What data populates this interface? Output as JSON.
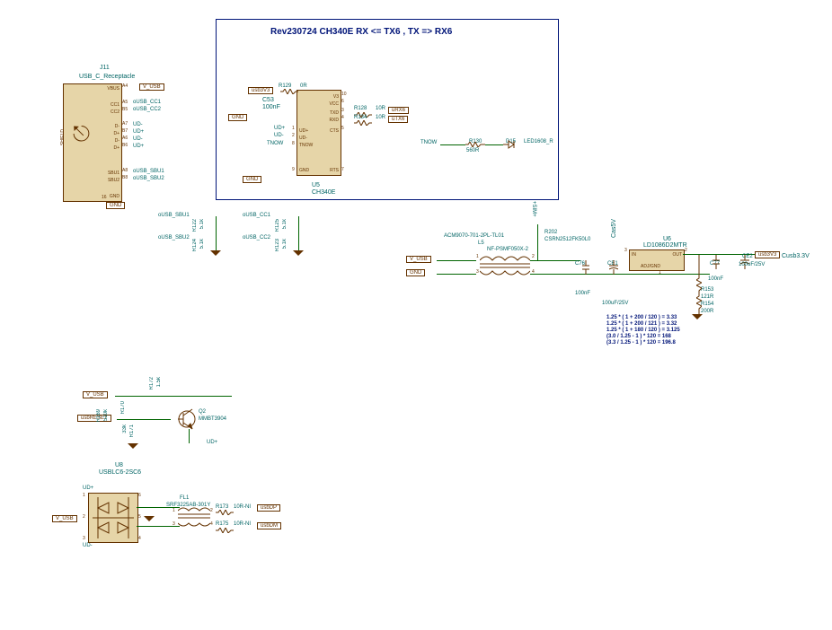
{
  "title": "Rev230724 CH340E RX <= TX6 , TX => RX6",
  "usb_conn": {
    "ref": "J11",
    "name": "USB_C_Receptacle",
    "shield": "SHIELD",
    "pins": {
      "vbus": "VBUS",
      "cc1": "CC1",
      "cc2": "CC2",
      "dn1": "D-",
      "dp1": "D+",
      "dn2": "D-",
      "dp2": "D+",
      "sbu1": "SBU1",
      "sbu2": "SBU2",
      "gnd": "GND"
    },
    "nos": {
      "a4": "A4",
      "a5": "A5",
      "b5": "B5",
      "a7": "A7",
      "b7": "B7",
      "a6": "A6",
      "b6": "B6",
      "a8": "A8",
      "b8": "B8",
      "g": "16"
    },
    "nets": {
      "vusb": "V_USB",
      "cc1": "oUSB_CC1",
      "cc2": "oUSB_CC2",
      "ud_m": "UD-",
      "ud_p": "UD+",
      "sbu1": "oUSB_SBU1",
      "sbu2": "oUSB_SBU2",
      "gnd": "GND"
    }
  },
  "ch340": {
    "ref": "U5",
    "name": "CH340E",
    "pins": {
      "v3": "V3",
      "vcc": "VCC",
      "txd": "TXD",
      "rxd": "RXD",
      "cts": "CTS",
      "udp": "UD+",
      "udm": "UD-",
      "tnow": "TNOW",
      "gnd": "GND",
      "rts": "RTS"
    },
    "pnos": {
      "v3": "10",
      "vcc": "6",
      "txd": "3",
      "rxd": "4",
      "cts": "5",
      "udp": "1",
      "udm": "2",
      "tnow": "8",
      "gnd": "9",
      "rts": "7"
    },
    "r129": {
      "ref": "R129",
      "val": "0R"
    },
    "c53": {
      "ref": "C53",
      "val": "100nF"
    },
    "tx": {
      "r": "R128",
      "v": "10R",
      "net": "uRX6"
    },
    "rx": {
      "r": "R134",
      "v": "10R",
      "net": "uTX6"
    },
    "tnow": {
      "r": "R130",
      "v": "560R",
      "d": "D15",
      "led": "LED1608_R",
      "lbl": "TNOW"
    },
    "gnd_net": "GND",
    "v33_net": "usb3V3"
  },
  "sbu": {
    "n1": "oUSB_SBU1",
    "n2": "oUSB_SBU2",
    "r1": "R122",
    "r2": "R124",
    "rv": "5.1k"
  },
  "cc": {
    "n1": "oUSB_CC1",
    "n2": "oUSB_CC2",
    "r1": "R125",
    "r2": "R123",
    "rv": "5.1k"
  },
  "psu": {
    "vusb": "V_USB",
    "gnd": "GND",
    "cm": {
      "name": "ACM9070-701-2PL-TL01",
      "ref": "L5",
      "sub": "NF-PSMF050X-2",
      "pins": {
        "a": "1",
        "b": "2",
        "c": "3",
        "d": "4"
      }
    },
    "r202": {
      "ref": "R202",
      "name": "CSRN2512FK50L0"
    },
    "c76": {
      "ref": "C76",
      "val": "100nF"
    },
    "ce1": {
      "ref": "CE1",
      "val": "100uF/25V"
    },
    "casev": "Cas5V",
    "reg": {
      "ref": "U6",
      "name": "LD1086D2MTR",
      "in": "IN",
      "out": "OUT",
      "adj": "ADJ/GND",
      "pi": "3",
      "po": "2",
      "pa": "1"
    },
    "c77": {
      "ref": "C77",
      "val": "100nF"
    },
    "ce2": {
      "ref": "CE2",
      "val": "100uF/25V"
    },
    "out_net": "usb3V3",
    "out_cls": "Cusb3.3V",
    "r153": {
      "ref": "R153",
      "val": "121R"
    },
    "r154": {
      "ref": "R154",
      "val": "200R"
    },
    "sim": "+SIM+"
  },
  "calc": [
    "1.25 * ( 1 + 200 / 120 ) = 3.33",
    "1.25 * ( 1 + 200 / 121 ) = 3.32",
    "1.25 * ( 1 + 180 / 120 ) = 3.125",
    "(3.0 / 1.25 - 1 ) * 120 = 168",
    "(3.3 / 1.25 - 1 ) * 120 = 196.8"
  ],
  "reset": {
    "vusb": "V_USB",
    "net": "usbRESET",
    "r170": "R170",
    "r172": {
      "ref": "R172",
      "val": "1.5k"
    },
    "r169": {
      "ref": "R169",
      "val": "510k"
    },
    "r171": {
      "ref": "R171",
      "val": "33k"
    },
    "q": {
      "ref": "Q2",
      "name": "MMBT3904"
    },
    "ud": "UD+"
  },
  "esd": {
    "ref": "U8",
    "name": "USBLC6-2SC6",
    "vusb": "V_USB",
    "udp": "UD+",
    "udm": "UD-",
    "fl": {
      "ref": "FL1",
      "name": "SRF3225AB-301Y",
      "p": {
        "a": "1",
        "b": "2",
        "c": "3",
        "d": "4"
      }
    },
    "rp": {
      "ref": "R173",
      "val": "10R-NI",
      "net": "usbDP"
    },
    "rm": {
      "ref": "R175",
      "val": "10R-NI",
      "net": "usbDM"
    },
    "pnos": {
      "tl": "1",
      "ml": "2",
      "bl": "3",
      "tr": "6",
      "mr": "5",
      "br": "4"
    }
  }
}
